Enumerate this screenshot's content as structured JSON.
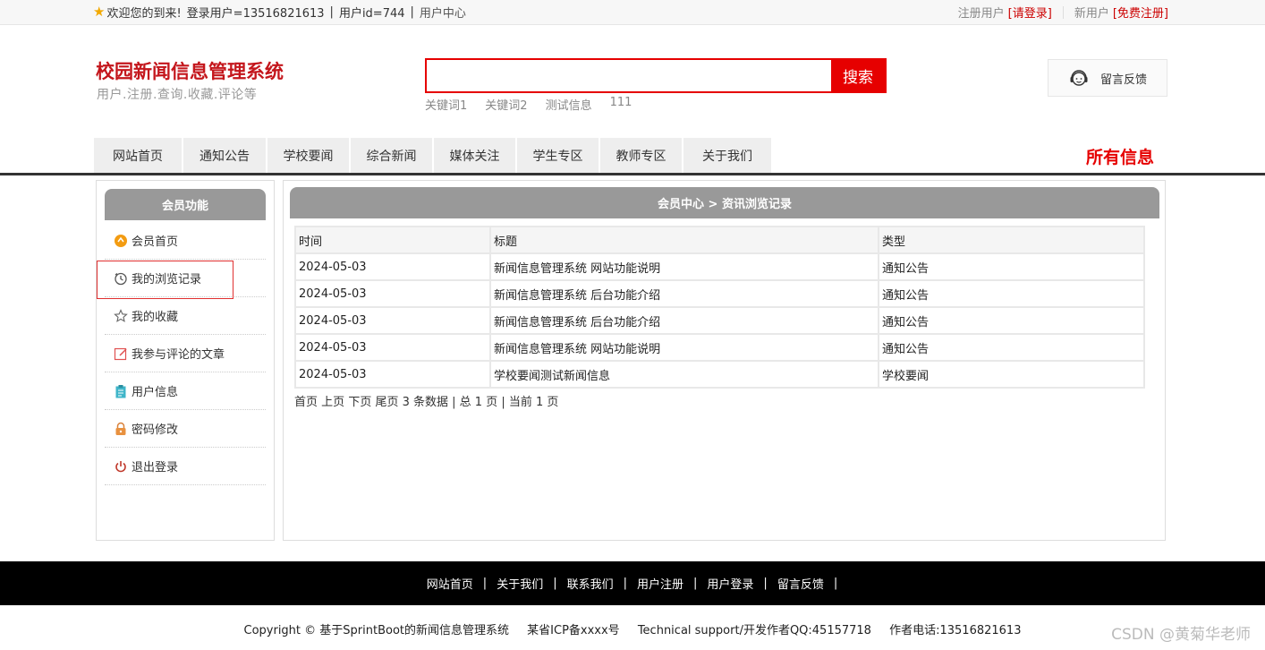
{
  "topbar": {
    "welcome": "欢迎您的到来!",
    "login_user": "登录用户=13516821613",
    "user_id": "用户id=744",
    "user_center": "用户中心",
    "reg_user": "注册用户",
    "please_login": "[请登录]",
    "new_user": "新用户",
    "free_register": "[免费注册]"
  },
  "header": {
    "title": "校园新闻信息管理系统",
    "subtitle": "用户.注册.查询.收藏.评论等",
    "search_button": "搜索",
    "search_value": "",
    "hotwords": [
      "关键词1",
      "关键词2",
      "测试信息",
      "111"
    ],
    "feedback": "留言反馈"
  },
  "nav": {
    "items": [
      "网站首页",
      "通知公告",
      "学校要闻",
      "综合新闻",
      "媒体关注",
      "学生专区",
      "教师专区",
      "关于我们"
    ],
    "all_info": "所有信息"
  },
  "sidebar": {
    "title": "会员功能",
    "items": [
      {
        "label": "会员首页",
        "icon": "home-icon"
      },
      {
        "label": "我的浏览记录",
        "icon": "history-icon"
      },
      {
        "label": "我的收藏",
        "icon": "star-icon"
      },
      {
        "label": "我参与评论的文章",
        "icon": "edit-icon"
      },
      {
        "label": "用户信息",
        "icon": "clipboard-icon"
      },
      {
        "label": "密码修改",
        "icon": "lock-icon"
      },
      {
        "label": "退出登录",
        "icon": "power-icon"
      }
    ]
  },
  "main": {
    "title": "会员中心 > 资讯浏览记录",
    "columns": [
      "时间",
      "标题",
      "类型"
    ],
    "rows": [
      [
        "2024-05-03",
        "新闻信息管理系统 网站功能说明",
        "通知公告"
      ],
      [
        "2024-05-03",
        "新闻信息管理系统 后台功能介绍",
        "通知公告"
      ],
      [
        "2024-05-03",
        "新闻信息管理系统 后台功能介绍",
        "通知公告"
      ],
      [
        "2024-05-03",
        "新闻信息管理系统 网站功能说明",
        "通知公告"
      ],
      [
        "2024-05-03",
        "学校要闻测试新闻信息",
        "学校要闻"
      ]
    ],
    "pager": {
      "first": "首页",
      "prev": "上页",
      "next": "下页",
      "last": "尾页",
      "summary": "3 条数据 | 总 1 页 | 当前 1 页"
    }
  },
  "footer": {
    "links": [
      "网站首页",
      "关于我们",
      "联系我们",
      "用户注册",
      "用户登录",
      "留言反馈"
    ],
    "copyright": "Copyright © 基于SprintBoot的新闻信息管理系统",
    "icp": "某省ICP备xxxx号",
    "support": "Technical support/开发作者QQ:45157718",
    "phone": "作者电话:13516821613",
    "watermark": "CSDN @黄菊华老师"
  },
  "colors": {
    "brand_red": "#c4161c",
    "search_red": "#e60000",
    "panel_gray": "#999999"
  }
}
